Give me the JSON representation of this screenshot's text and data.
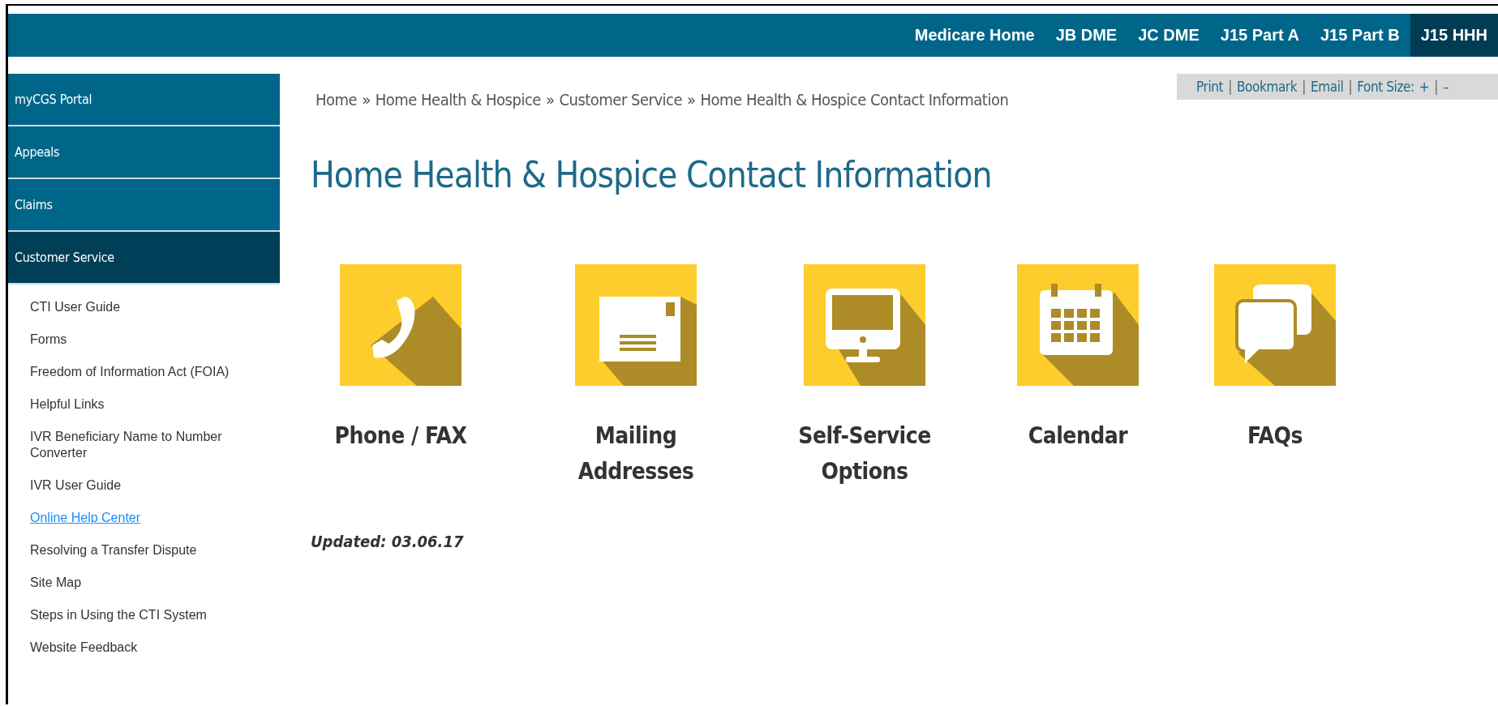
{
  "top_nav": [
    {
      "label": "Medicare Home",
      "selected": false
    },
    {
      "label": "JB DME",
      "selected": false
    },
    {
      "label": "JC DME",
      "selected": false
    },
    {
      "label": "J15 Part A",
      "selected": false
    },
    {
      "label": "J15 Part B",
      "selected": false
    },
    {
      "label": "J15 HHH",
      "selected": true
    }
  ],
  "sidebar": {
    "items": [
      {
        "label": "myCGS Portal",
        "selected": false
      },
      {
        "label": "Appeals",
        "selected": false
      },
      {
        "label": "Claims",
        "selected": false
      },
      {
        "label": "Customer Service",
        "selected": true,
        "children": [
          {
            "label": "CTI User Guide",
            "hovered": false
          },
          {
            "label": "Forms",
            "hovered": false
          },
          {
            "label": "Freedom of Information Act (FOIA)",
            "hovered": false
          },
          {
            "label": "Helpful Links",
            "hovered": false
          },
          {
            "label": "IVR Beneficiary Name to Number Converter",
            "hovered": false
          },
          {
            "label": "IVR User Guide",
            "hovered": false
          },
          {
            "label": "Online Help Center",
            "hovered": true
          },
          {
            "label": "Resolving a Transfer Dispute",
            "hovered": false
          },
          {
            "label": "Site Map",
            "hovered": false
          },
          {
            "label": "Steps in Using the CTI System",
            "hovered": false
          },
          {
            "label": "Website Feedback",
            "hovered": false
          }
        ]
      }
    ]
  },
  "breadcrumb": [
    "Home",
    "Home Health & Hospice",
    "Customer Service",
    "Home Health & Hospice Contact Information"
  ],
  "breadcrumb_separator": "»",
  "page_tools": {
    "separator": "|",
    "links": [
      "Print",
      "Bookmark",
      "Email"
    ],
    "font_size_label": "Font Size:",
    "increase": "+",
    "decrease": "–"
  },
  "title": "Home Health & Hospice Contact Information",
  "tiles": [
    {
      "kind": "phone",
      "label": "Phone / FAX"
    },
    {
      "kind": "mail",
      "label": "Mailing Addresses"
    },
    {
      "kind": "monitor",
      "label": "Self-Service Options"
    },
    {
      "kind": "calendar",
      "label": "Calendar"
    },
    {
      "kind": "chat",
      "label": "FAQs"
    }
  ],
  "updated": "Updated: 03.06.17"
}
